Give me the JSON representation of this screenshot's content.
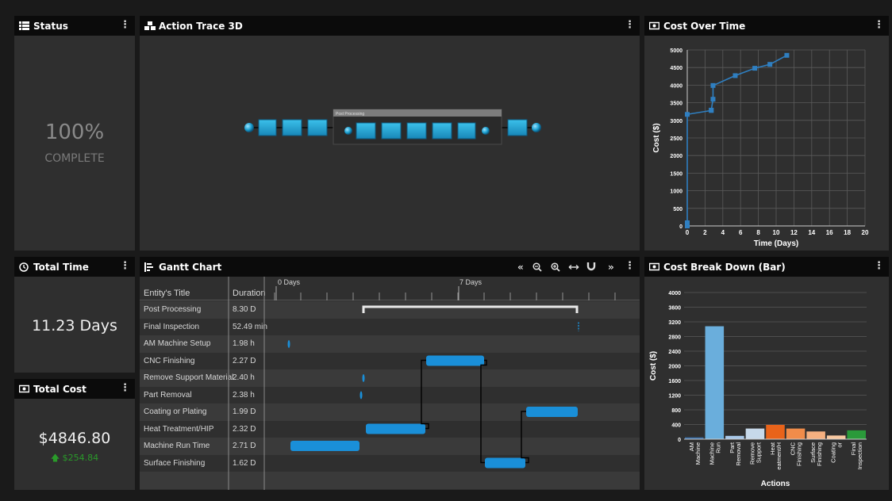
{
  "status_panel": {
    "title": "Status",
    "percent": "100%",
    "label": "COMPLETE"
  },
  "trace_panel": {
    "title": "Action Trace 3D",
    "group_label": "Post Processing"
  },
  "total_time_panel": {
    "title": "Total Time",
    "value": "11.23 Days"
  },
  "total_cost_panel": {
    "title": "Total Cost",
    "value": "$4846.80",
    "delta": "$254.84"
  },
  "gantt_panel": {
    "title": "Gantt Chart",
    "col_title": "Entity's Title",
    "col_duration": "Duration",
    "axis_labels": [
      "0 Days",
      "7 Days"
    ],
    "rows": [
      {
        "title": "Post Processing",
        "duration": "8.30 D"
      },
      {
        "title": "Final Inspection",
        "duration": "52.49 min"
      },
      {
        "title": "AM Machine Setup",
        "duration": "1.98 h"
      },
      {
        "title": "CNC Finishing",
        "duration": "2.27 D"
      },
      {
        "title": "Remove Support Material",
        "duration": "2.40 h"
      },
      {
        "title": "Part Removal",
        "duration": "2.38 h"
      },
      {
        "title": "Coating or Plating",
        "duration": "1.99 D"
      },
      {
        "title": "Heat Treatment/HIP",
        "duration": "2.32 D"
      },
      {
        "title": "Machine Run Time",
        "duration": "2.71 D"
      },
      {
        "title": "Surface Finishing",
        "duration": "1.62 D"
      }
    ],
    "toolbar": {
      "prev": "«",
      "zoom_out": "zoom-out-icon",
      "zoom_in": "zoom-in-icon",
      "fit": "fit-width-icon",
      "snap": "magnet-icon",
      "next": "»"
    }
  },
  "cost_over_time_panel": {
    "title": "Cost Over Time"
  },
  "cost_breakdown_panel": {
    "title": "Cost Break Down (Bar)"
  },
  "colors": {
    "accent_blue": "#1a8fd8",
    "line_blue": "#2f7fc1",
    "positive_green": "#2a9a2a",
    "panel_bg": "#2f2f2f",
    "header_bg": "#0b0b0b"
  },
  "chart_data": [
    {
      "type": "line",
      "title": "Cost Over Time",
      "xlabel": "Time (Days)",
      "ylabel": "Cost ($)",
      "xlim": [
        0,
        20
      ],
      "ylim": [
        0,
        5000
      ],
      "xticks": [
        0,
        2,
        4,
        6,
        8,
        10,
        12,
        14,
        16,
        18,
        20
      ],
      "yticks": [
        0,
        500,
        1000,
        1500,
        2000,
        2500,
        3000,
        3500,
        4000,
        4500,
        5000
      ],
      "grid": true,
      "series": [
        {
          "x": [
            0,
            0,
            0,
            2.7,
            2.7,
            2.9,
            2.9,
            5.4,
            7.6,
            9.3,
            11.2
          ],
          "y": [
            0,
            90,
            3170,
            3280,
            3290,
            3600,
            3990,
            4270,
            4480,
            4590,
            4847
          ]
        }
      ]
    },
    {
      "type": "bar",
      "title": "Cost Break Down (Bar)",
      "xlabel": "Actions",
      "ylabel": "Cost ($)",
      "ylim": [
        0,
        4000
      ],
      "yticks": [
        0,
        400,
        800,
        1200,
        1600,
        2000,
        2400,
        2800,
        3200,
        3600,
        4000
      ],
      "grid": true,
      "categories": [
        "AM Machine",
        "Machine Run",
        "Part Removal",
        "Remove Support",
        "Heat eatment/H",
        "CNC Finishing",
        "Surface Finishing",
        "Coating or",
        "Final Inspection"
      ],
      "values": [
        50,
        3080,
        90,
        290,
        390,
        290,
        210,
        100,
        240
      ],
      "colors": [
        "#3a6fa8",
        "#6aaedc",
        "#a8c8e8",
        "#c7d9ea",
        "#e8631a",
        "#f08c4a",
        "#f5b080",
        "#f8c8a0",
        "#2a9a3a"
      ]
    }
  ]
}
